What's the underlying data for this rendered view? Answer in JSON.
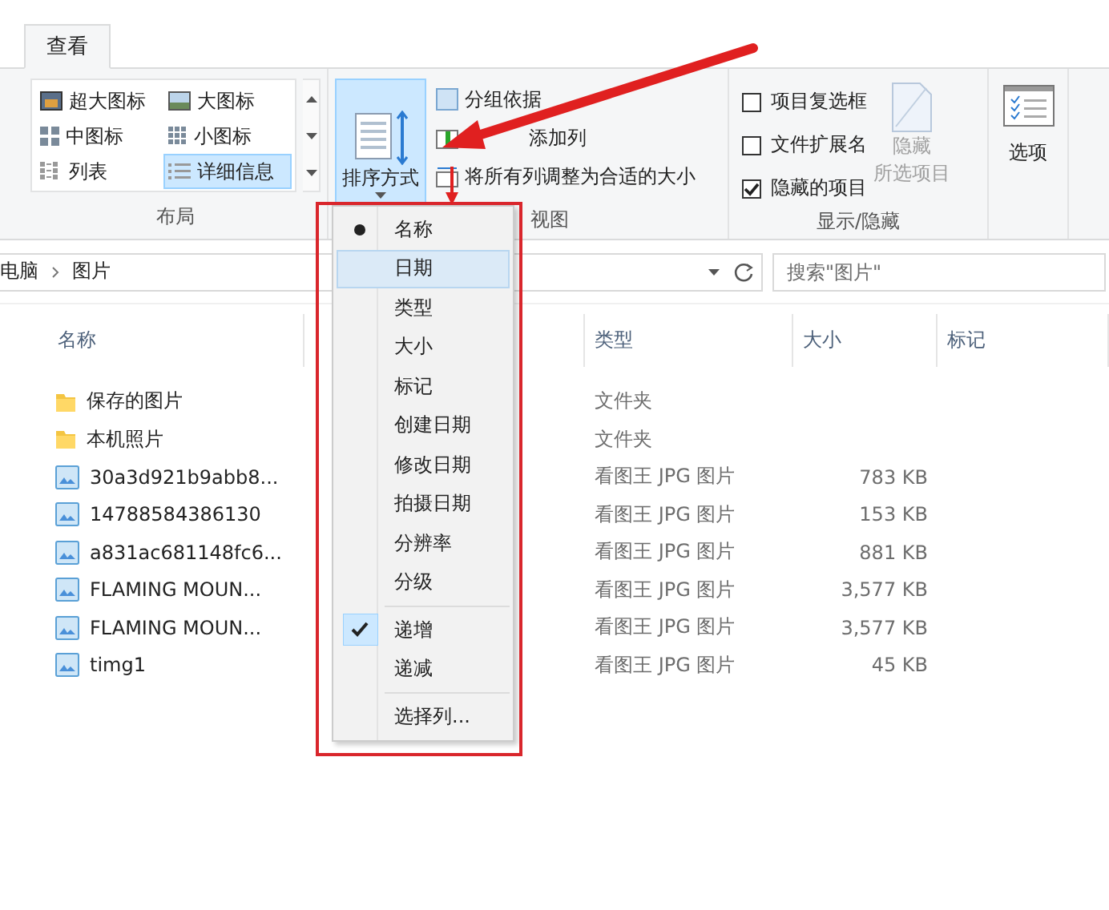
{
  "tabs": [
    {
      "label": "查看",
      "selected": true
    }
  ],
  "layout_group": {
    "label": "布局",
    "items": [
      {
        "label": "超大图标",
        "kind": "xl",
        "selected": false
      },
      {
        "label": "大图标",
        "kind": "large",
        "selected": false
      },
      {
        "label": "中图标",
        "kind": "medium",
        "selected": false
      },
      {
        "label": "小图标",
        "kind": "small",
        "selected": false
      },
      {
        "label": "列表",
        "kind": "list",
        "selected": false
      },
      {
        "label": "详细信息",
        "kind": "details",
        "selected": true
      }
    ]
  },
  "view_group": {
    "label": "视图",
    "sort_button": "排序方式",
    "items": [
      {
        "label": "分组依据",
        "kind": "group"
      },
      {
        "label": "添加列",
        "kind": "addcol"
      },
      {
        "label": "将所有列调整为合适的大小",
        "kind": "fit"
      }
    ]
  },
  "show_group": {
    "label": "显示/隐藏",
    "checkboxes": [
      {
        "label": "项目复选框",
        "checked": false
      },
      {
        "label": "文件扩展名",
        "checked": false
      },
      {
        "label": "隐藏的项目",
        "checked": true
      }
    ],
    "hide_button": {
      "lines": [
        "隐藏",
        "所选项目"
      ],
      "disabled": true
    }
  },
  "options_button": "选项",
  "address": {
    "path": [
      "电脑",
      "图片"
    ]
  },
  "search": {
    "placeholder": "搜索\"图片\""
  },
  "columns": [
    "名称",
    "类型",
    "大小",
    "标记"
  ],
  "rows": [
    {
      "name": "保存的图片",
      "kind": "folder",
      "type": "文件夹"
    },
    {
      "name": "本机照片",
      "kind": "folder",
      "type": "文件夹"
    },
    {
      "name": "30a3d921b9abb8...",
      "kind": "image",
      "type": "看图王 JPG 图片",
      "size": "783 KB"
    },
    {
      "name": "14788584386130",
      "kind": "image",
      "type": "看图王 JPG 图片",
      "size": "153 KB"
    },
    {
      "name": "a831ac681148fc6...",
      "kind": "image",
      "type": "看图王 JPG 图片",
      "size": "881 KB"
    },
    {
      "name": "FLAMING MOUN...",
      "kind": "image",
      "type": "看图王 JPG 图片",
      "size": "3,577 KB"
    },
    {
      "name": "FLAMING MOUN...",
      "kind": "image",
      "type": "看图王 JPG 图片",
      "size": "3,577 KB"
    },
    {
      "name": "timg1",
      "kind": "image",
      "type": "看图王 JPG 图片",
      "size": "45 KB"
    }
  ],
  "sort_menu": {
    "sections": [
      [
        {
          "label": "名称",
          "kind": "radio",
          "selected": true,
          "hovered": false
        },
        {
          "label": "日期",
          "kind": "radio",
          "selected": false,
          "hovered": true
        },
        {
          "label": "类型",
          "kind": "radio",
          "selected": false,
          "hovered": false
        },
        {
          "label": "大小",
          "kind": "radio",
          "selected": false,
          "hovered": false
        },
        {
          "label": "标记",
          "kind": "radio",
          "selected": false,
          "hovered": false
        },
        {
          "label": "创建日期",
          "kind": "radio",
          "selected": false,
          "hovered": false
        },
        {
          "label": "修改日期",
          "kind": "radio",
          "selected": false,
          "hovered": false
        },
        {
          "label": "拍摄日期",
          "kind": "radio",
          "selected": false,
          "hovered": false
        },
        {
          "label": "分辨率",
          "kind": "radio",
          "selected": false,
          "hovered": false
        },
        {
          "label": "分级",
          "kind": "radio",
          "selected": false,
          "hovered": false
        }
      ],
      [
        {
          "label": "递增",
          "kind": "check",
          "selected": true,
          "hovered": false
        },
        {
          "label": "递减",
          "kind": "check",
          "selected": false,
          "hovered": false
        }
      ],
      [
        {
          "label": "选择列...",
          "kind": "plain",
          "selected": false,
          "hovered": false
        }
      ]
    ]
  }
}
